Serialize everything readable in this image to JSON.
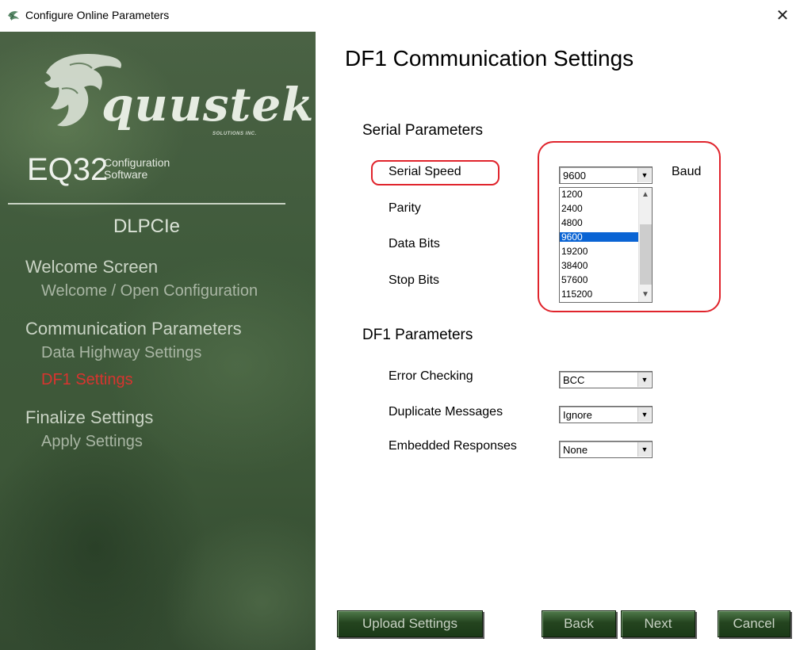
{
  "window": {
    "title": "Configure Online Parameters",
    "close_glyph": "✕",
    "icon": "app-icon"
  },
  "sidebar": {
    "logo_text": "quustek",
    "logo_sub": "SOLUTIONS INC.",
    "product": "EQ32",
    "product_sub1": "Configuration",
    "product_sub2": "Software",
    "model": "DLPCIe",
    "sections": [
      {
        "heading": "Welcome Screen",
        "items": [
          "Welcome / Open Configuration"
        ]
      },
      {
        "heading": "Communication Parameters",
        "items": [
          "Data Highway Settings",
          "DF1 Settings"
        ]
      },
      {
        "heading": "Finalize Settings",
        "items": [
          "Apply Settings"
        ]
      }
    ],
    "active_item": "DF1 Settings",
    "active_color": "#d8342f"
  },
  "main": {
    "title": "DF1 Communication Settings",
    "serial": {
      "heading": "Serial Parameters",
      "labels": [
        "Serial Speed",
        "Parity",
        "Data Bits",
        "Stop Bits"
      ],
      "speed_value": "9600",
      "speed_unit": "Baud",
      "speed_options": [
        "1200",
        "2400",
        "4800",
        "9600",
        "19200",
        "38400",
        "57600",
        "115200"
      ],
      "speed_selected": "9600"
    },
    "df1": {
      "heading": "DF1 Parameters",
      "labels": [
        "Error Checking",
        "Duplicate Messages",
        "Embedded Responses"
      ],
      "values": [
        "BCC",
        "Ignore",
        "None"
      ]
    },
    "highlight_color": "#e0242c"
  },
  "buttons": {
    "upload": "Upload Settings",
    "back": "Back",
    "next": "Next",
    "cancel": "Cancel"
  }
}
